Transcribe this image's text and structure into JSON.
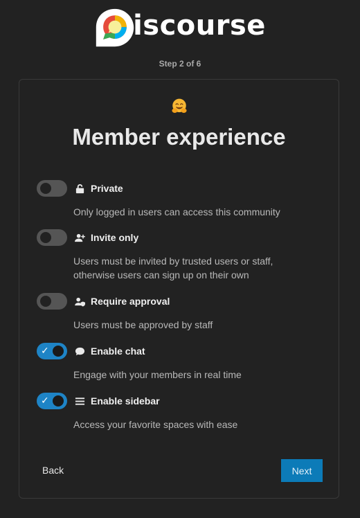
{
  "logo": {
    "text": "iscourse",
    "icon": "discourse-logo-icon"
  },
  "step": "Step  2 of 6",
  "card": {
    "emoji": "hugging-face-emoji-icon",
    "title": "Member experience"
  },
  "options": [
    {
      "icon": "unlock-icon",
      "label": "Private",
      "desc": "Only logged in users can access this community",
      "enabled": false
    },
    {
      "icon": "user-plus-icon",
      "label": "Invite only",
      "desc": "Users must be invited by trusted users or staff, otherwise users can sign up on their own",
      "enabled": false
    },
    {
      "icon": "user-shield-icon",
      "label": "Require approval",
      "desc": "Users must be approved by staff",
      "enabled": false
    },
    {
      "icon": "comment-icon",
      "label": "Enable chat",
      "desc": "Engage with your members in real time",
      "enabled": true
    },
    {
      "icon": "bars-icon",
      "label": "Enable sidebar",
      "desc": "Access your favorite spaces with ease",
      "enabled": true
    }
  ],
  "buttons": {
    "back": "Back",
    "next": "Next"
  },
  "colors": {
    "accent": "#1e84c6",
    "next_button": "#0c7bb8",
    "background": "#222222"
  }
}
